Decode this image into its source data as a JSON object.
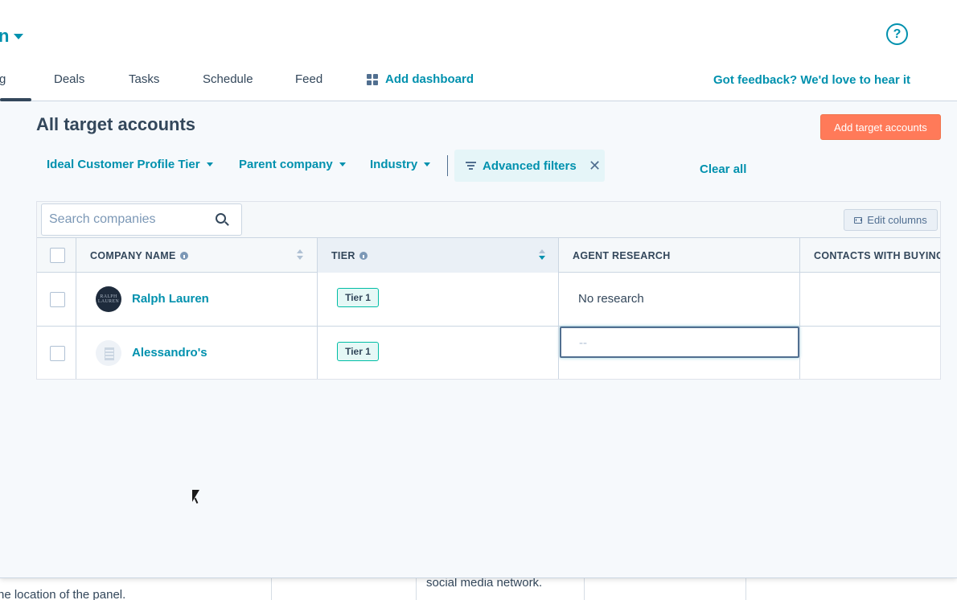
{
  "header": {
    "brand": "n",
    "help": "?"
  },
  "tabs": [
    {
      "label": "g"
    },
    {
      "label": "Deals"
    },
    {
      "label": "Tasks"
    },
    {
      "label": "Schedule"
    },
    {
      "label": "Feed"
    }
  ],
  "add_dashboard": "Add dashboard",
  "feedback": "Got feedback? We'd love to hear it",
  "page_title": "All target accounts",
  "add_button": "Add target accounts",
  "filters": {
    "icp_tier": "Ideal Customer Profile Tier",
    "parent_company": "Parent company",
    "industry": "Industry",
    "advanced": "Advanced filters",
    "clear_all": "Clear all"
  },
  "search": {
    "placeholder": "Search companies"
  },
  "edit_columns": "Edit columns",
  "columns": [
    "COMPANY NAME",
    "TIER",
    "AGENT RESEARCH",
    "CONTACTS WITH BUYING"
  ],
  "rows": [
    {
      "company": "Ralph Lauren",
      "logo_text": "RALPH LAUREN",
      "tier": "Tier 1",
      "research": "No research"
    },
    {
      "company": "Alessandro's",
      "tier": "Tier 1",
      "research": "--"
    }
  ],
  "background_text": {
    "left": "ne location of the panel.",
    "middle": "social media network."
  },
  "colors": {
    "accent": "#0091ae",
    "primary_button": "#ff7a59",
    "text": "#33475b"
  }
}
